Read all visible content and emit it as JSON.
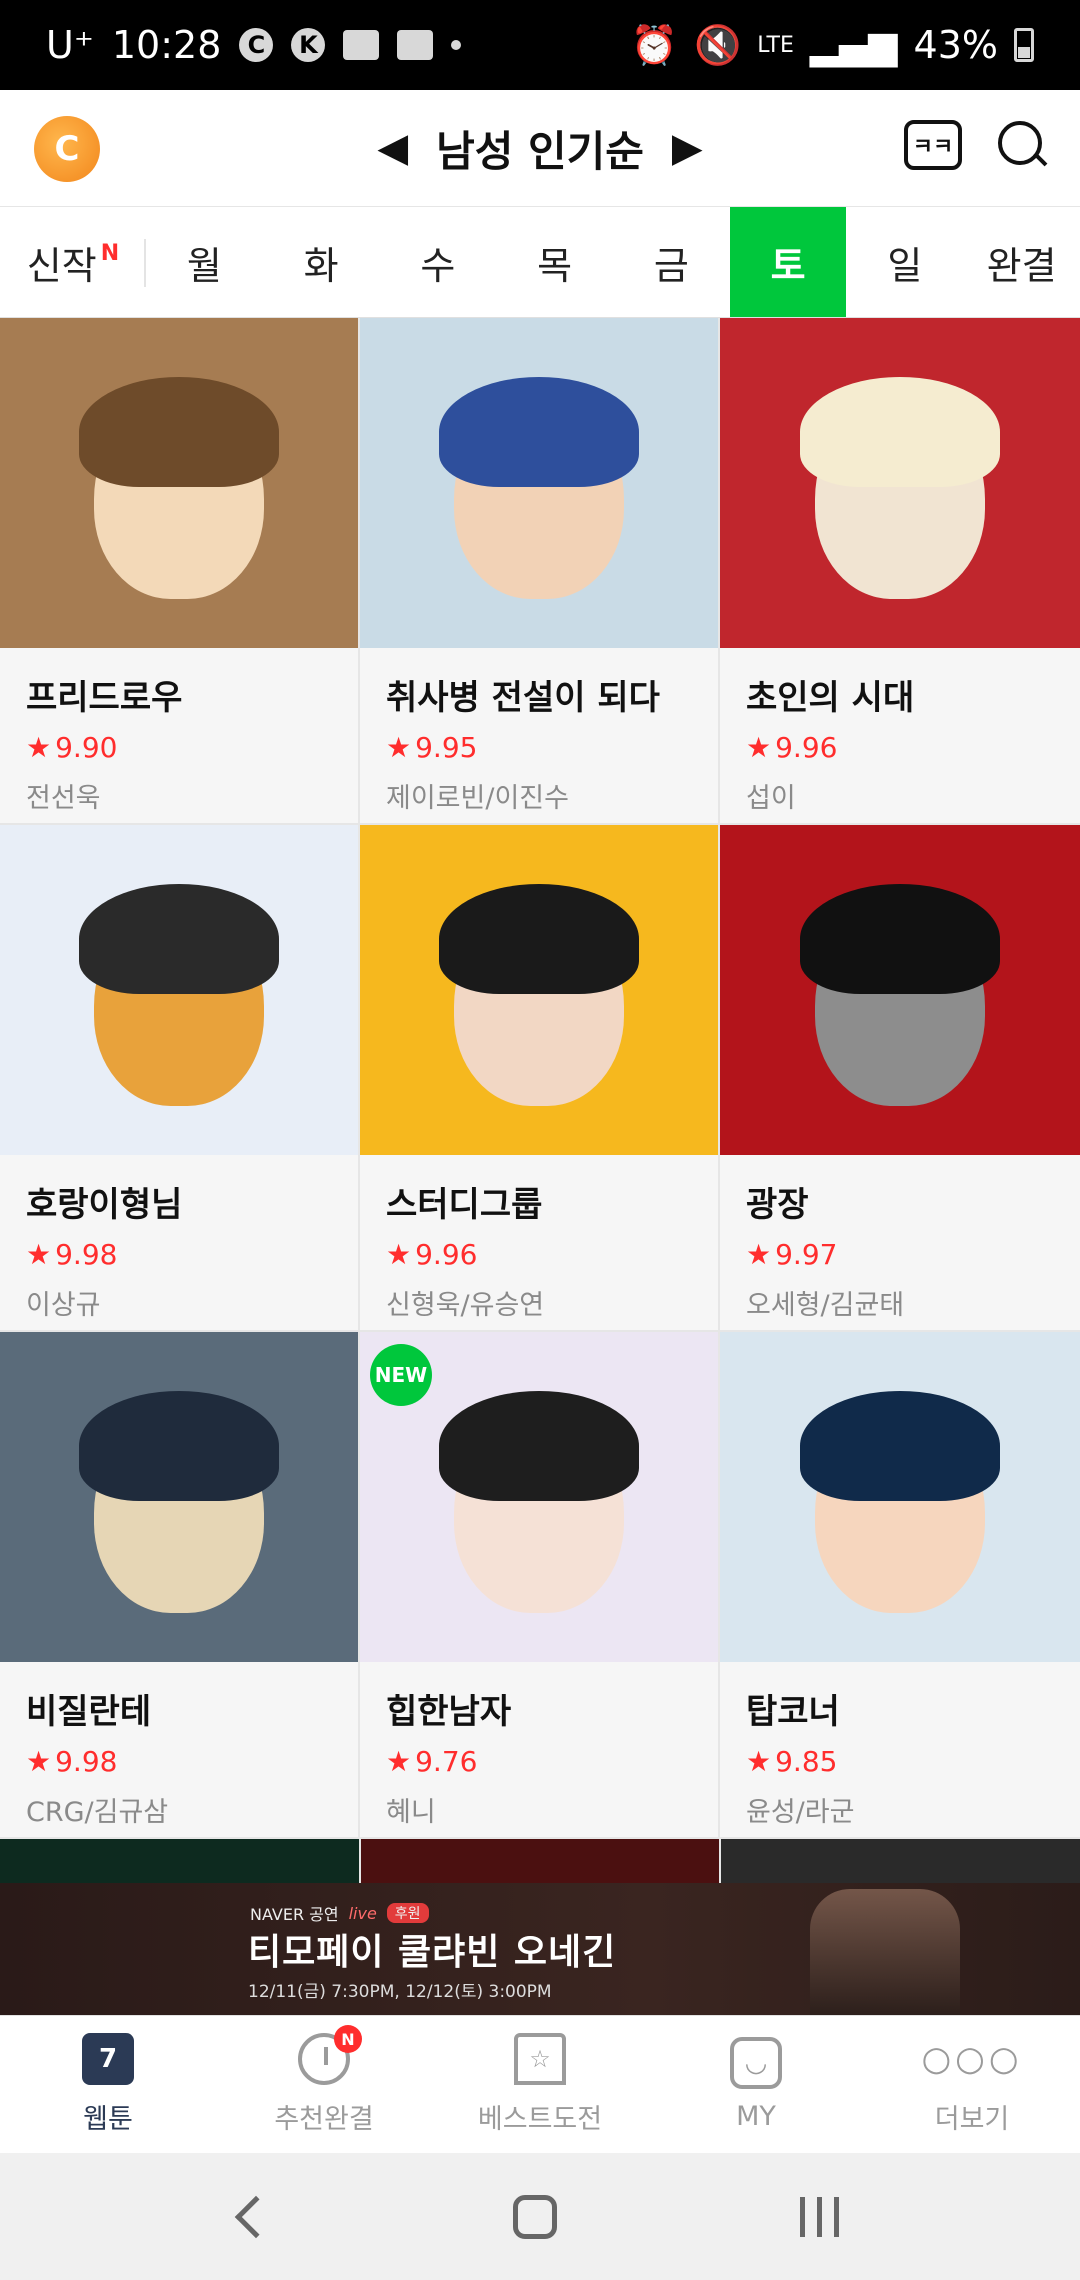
{
  "status_bar": {
    "carrier": "U⁺",
    "time": "10:28",
    "battery": "43%",
    "network": "LTE"
  },
  "header": {
    "title": "남성 인기순",
    "prev_icon": "triangle-left-icon",
    "next_icon": "triangle-right-icon",
    "chat_icon_text": "ㅋㅋ"
  },
  "tabs": {
    "new_label": "신작",
    "new_badge": "N",
    "days": [
      "월",
      "화",
      "수",
      "목",
      "금",
      "토",
      "일",
      "완결"
    ],
    "active": "토"
  },
  "comics": [
    {
      "title": "프리드로우",
      "rating": "9.90",
      "author": "전선욱",
      "thumb_colors": [
        "#a67c52",
        "#f3d9b8",
        "#6e4b2a"
      ]
    },
    {
      "title": "취사병 전설이 되다",
      "rating": "9.95",
      "author": "제이로빈/이진수",
      "thumb_colors": [
        "#c9dbe6",
        "#f2d2b6",
        "#2e4f9c"
      ]
    },
    {
      "title": "초인의 시대",
      "rating": "9.96",
      "author": "섭이",
      "thumb_colors": [
        "#c0262d",
        "#f1e4d2",
        "#f5ecd0"
      ]
    },
    {
      "title": "호랑이형님",
      "rating": "9.98",
      "author": "이상규",
      "thumb_colors": [
        "#e8eef7",
        "#e8a23b",
        "#2a2a2a"
      ]
    },
    {
      "title": "스터디그룹",
      "rating": "9.96",
      "author": "신형욱/유승연",
      "thumb_colors": [
        "#f6b81e",
        "#f2d7c4",
        "#1a1a1a"
      ]
    },
    {
      "title": "광장",
      "rating": "9.97",
      "author": "오세형/김균태",
      "thumb_colors": [
        "#b3141b",
        "#8d8d8d",
        "#111111"
      ]
    },
    {
      "title": "비질란테",
      "rating": "9.98",
      "author": "CRG/김규삼",
      "thumb_colors": [
        "#5a6b7a",
        "#e6d6b5",
        "#1f2b3c"
      ]
    },
    {
      "title": "힙한남자",
      "rating": "9.76",
      "author": "혜니",
      "thumb_colors": [
        "#ece6f3",
        "#f5e1d6",
        "#1e1e1e"
      ],
      "badge": "NEW"
    },
    {
      "title": "탑코너",
      "rating": "9.85",
      "author": "윤성/라군",
      "thumb_colors": [
        "#d9e6ef",
        "#f6d6be",
        "#102a4a"
      ]
    }
  ],
  "peek_colors": [
    "#0d2a1f",
    "#4b1010",
    "#2a2a2a"
  ],
  "banner": {
    "tagline_brand": "NAVER 공연",
    "tagline_live": "live",
    "tagline_sponsor": "후원",
    "title": "티모페이 쿨랴빈 오네긴",
    "subtitle": "12/11(금) 7:30PM, 12/12(토) 3:00PM"
  },
  "bottom_nav": [
    {
      "label": "웹툰",
      "icon": "calendar-icon",
      "icon_text": "7",
      "active": true
    },
    {
      "label": "추천완결",
      "icon": "clock-icon",
      "badge": "N"
    },
    {
      "label": "베스트도전",
      "icon": "bookmark-star-icon",
      "icon_text": "☆"
    },
    {
      "label": "MY",
      "icon": "smile-icon",
      "icon_text": "◡"
    },
    {
      "label": "더보기",
      "icon": "more-icon",
      "icon_text": "○○○"
    }
  ]
}
